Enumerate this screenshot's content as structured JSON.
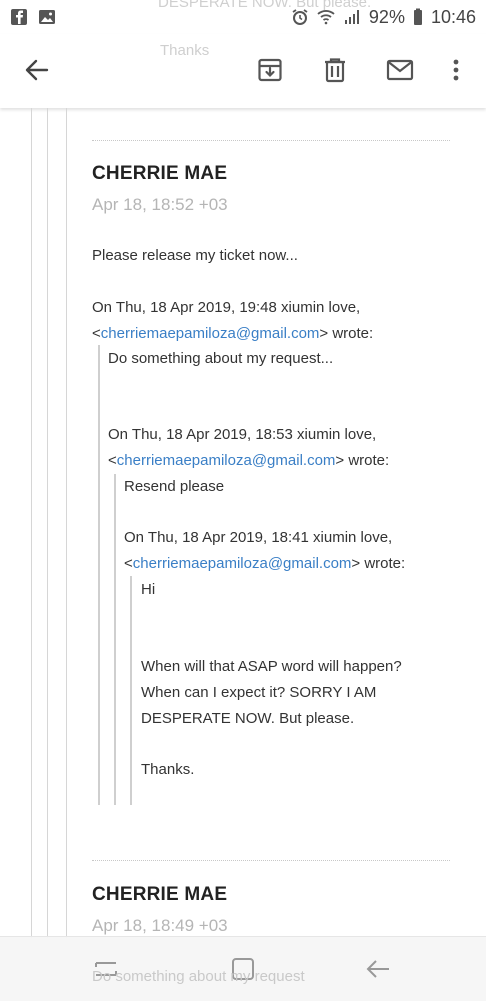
{
  "status": {
    "battery": "92%",
    "time": "10:46"
  },
  "ghost": {
    "top_line": "DESPERATE NOW. But please.",
    "second_line": "Thanks"
  },
  "messages": [
    {
      "sender": "CHERRIE MAE",
      "date": "Apr 18, 18:52 +03",
      "body": "Please release my ticket now...",
      "q1_header_a": "On Thu, 18 Apr 2019, 19:48 xiumin love,",
      "q1_header_lt": "<",
      "q1_email": "cherriemaepamiloza@gmail.com",
      "q1_header_b": "> wrote:",
      "q1_text": "Do something about my request...",
      "q2_header_a": "On Thu, 18 Apr 2019, 18:53 xiumin love,",
      "q2_header_lt": "<",
      "q2_email": "cherriemaepamiloza@gmail.com",
      "q2_header_b": "> wrote:",
      "q2_text": "Resend please",
      "q3_header_a": "On Thu, 18 Apr 2019, 18:41 xiumin love,",
      "q3_header_lt": "<",
      "q3_email": "cherriemaepamiloza@gmail.com",
      "q3_header_b": "> wrote:",
      "q3_hi": "Hi",
      "q3_line1": "When will that ASAP word  will happen?",
      "q3_line2": "When can I expect it? SORRY I AM",
      "q3_line3": "DESPERATE NOW. But please.",
      "q3_thanks": "Thanks."
    },
    {
      "sender": "CHERRIE MAE",
      "date": "Apr 18, 18:49 +03",
      "preview": "Do something about my request"
    }
  ]
}
